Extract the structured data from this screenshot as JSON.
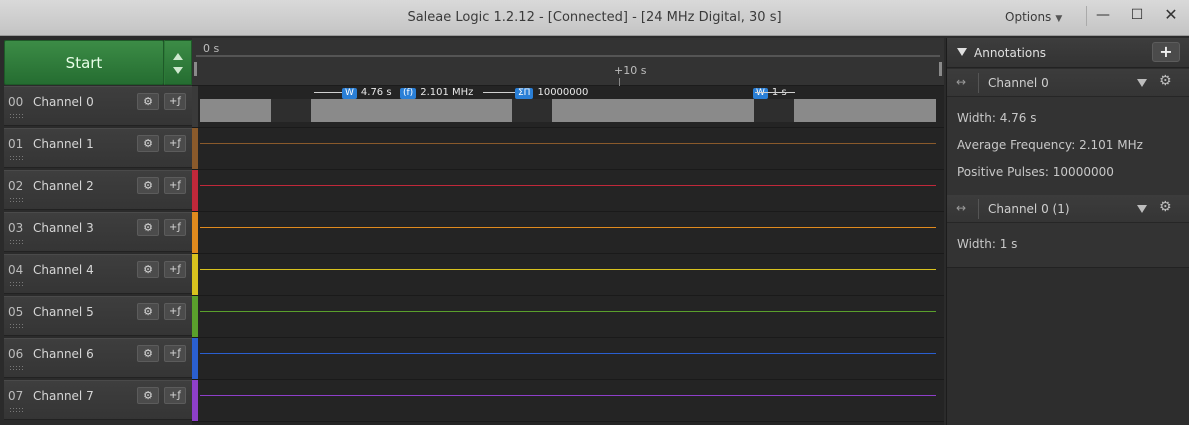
{
  "window": {
    "title": "Saleae Logic 1.2.12 - [Connected] - [24 MHz Digital, 30 s]",
    "options_label": "Options",
    "minimize_glyph": "—",
    "maximize_glyph": "☐",
    "close_glyph": "✕"
  },
  "controls": {
    "start_label": "Start"
  },
  "ruler": {
    "start_label": "0 s",
    "mark_label": "+10 s"
  },
  "channels": [
    {
      "num": "00",
      "name": "Channel 0",
      "color": "#8a8a8a"
    },
    {
      "num": "01",
      "name": "Channel 1",
      "color": "#8a5a2b"
    },
    {
      "num": "02",
      "name": "Channel 2",
      "color": "#c0283a"
    },
    {
      "num": "03",
      "name": "Channel 3",
      "color": "#e08a1e"
    },
    {
      "num": "04",
      "name": "Channel 4",
      "color": "#d8c21e"
    },
    {
      "num": "05",
      "name": "Channel 5",
      "color": "#5aa02c"
    },
    {
      "num": "06",
      "name": "Channel 6",
      "color": "#2a5fd0"
    },
    {
      "num": "07",
      "name": "Channel 7",
      "color": "#8e3fc9"
    }
  ],
  "waveform_annotations": {
    "width_tag": "W",
    "width_value": "4.76 s",
    "freq_tag": "(f)",
    "freq_value": "2.101 MHz",
    "pulses_tag": "ΣΠ",
    "pulses_value": "10000000",
    "width2_tag": "W",
    "width2_value": "1 s"
  },
  "annotations_panel": {
    "title": "Annotations",
    "add_glyph": "+",
    "groups": [
      {
        "channel": "Channel 0",
        "lines": [
          "Width: 4.76 s",
          "Average Frequency: 2.101 MHz",
          "Positive Pulses: 10000000"
        ]
      },
      {
        "channel": "Channel 0 (1)",
        "lines": [
          "Width: 1 s"
        ]
      }
    ]
  },
  "icons": {
    "gear": "⚙",
    "trigger": "+ƒ",
    "range": "↔"
  }
}
